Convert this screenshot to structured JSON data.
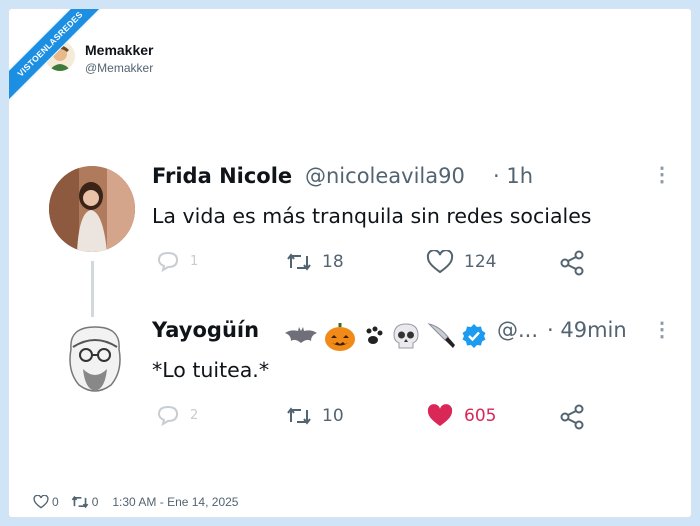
{
  "watermark": "VISTOENLASREDES",
  "poster": {
    "name": "Memakker",
    "handle": "@Memakker"
  },
  "tweets": [
    {
      "name": "Frida Nicole",
      "handle": "@nicoleavila90",
      "time": "· 1h",
      "text": "La vida es más tranquila sin redes sociales",
      "replies": "1",
      "retweets": "18",
      "likes": "124"
    },
    {
      "name": "Yayogüín",
      "handle": "@...",
      "time": "· 49min",
      "text": "*Lo tuitea.*",
      "emojis": [
        "bat-icon",
        "pumpkin-icon",
        "paw-icon",
        "skull-icon",
        "knife-icon",
        "verified-badge-icon"
      ],
      "replies": "2",
      "retweets": "10",
      "likes": "605"
    }
  ],
  "footer": {
    "likes": "0",
    "retweets": "0",
    "timestamp": "1:30 AM - Ene 14, 2025"
  },
  "colors": {
    "like_red": "#d92757",
    "verified_blue": "#1d9bf0",
    "accent": "#1d8fe3"
  }
}
